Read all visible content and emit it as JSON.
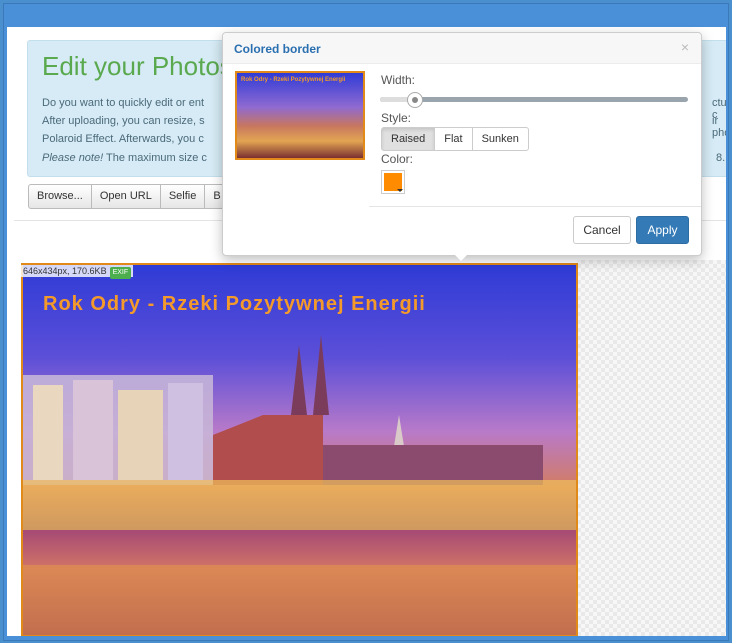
{
  "info": {
    "title": "Edit your Photos",
    "line1": "Do you want to quickly edit or ent",
    "line1_right": "cture c",
    "line2": "After uploading, you can resize, s",
    "line2_right": "ir phot",
    "line3": "Polaroid Effect. Afterwards, you c",
    "note_prefix": "Please note!",
    "line4": " The maximum size c",
    "line4_right": "8."
  },
  "toolbar": {
    "browse": "Browse...",
    "open_url": "Open URL",
    "selfie": "Selfie",
    "partial": "B"
  },
  "image": {
    "meta": "646x434px, 170.6KB",
    "exif_badge": "EXIF",
    "photo_text": "Rok Odry - Rzeki Pozytywnej Energii"
  },
  "popover": {
    "title": "Colored border",
    "close": "×",
    "thumb_text": "Rok Odry - Rzeki Pozytywnej Energii",
    "width_label": "Width:",
    "width_value_fraction": 0.11,
    "style_label": "Style:",
    "styles": [
      "Raised",
      "Flat",
      "Sunken"
    ],
    "active_style": "Raised",
    "color_label": "Color:",
    "color": "#ff8c00",
    "cancel": "Cancel",
    "apply": "Apply"
  },
  "colors": {
    "accent_blue": "#337ab7",
    "title_green": "#5aa94f",
    "border_orange": "#e18a1a"
  }
}
